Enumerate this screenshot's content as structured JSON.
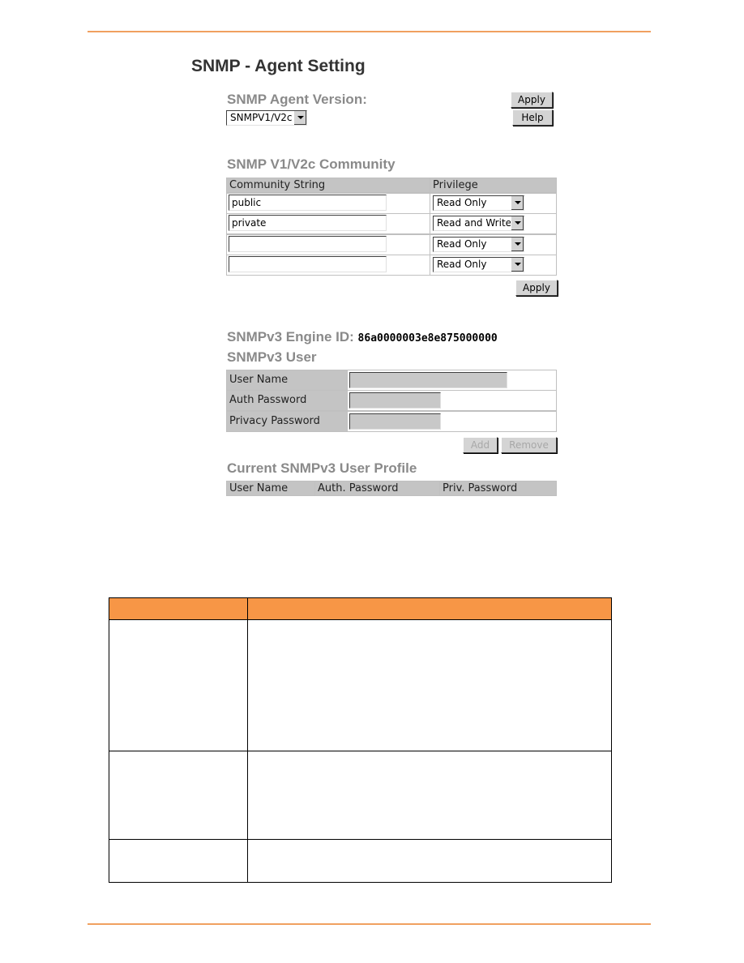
{
  "title": "SNMP - Agent Setting",
  "agent_version": {
    "label": "SNMP Agent Version:",
    "selected": "SNMPV1/V2c",
    "apply": "Apply",
    "help": "Help"
  },
  "community": {
    "heading": "SNMP V1/V2c Community",
    "columns": [
      "Community String",
      "Privilege"
    ],
    "rows": [
      {
        "string": "public",
        "privilege": "Read Only"
      },
      {
        "string": "private",
        "privilege": "Read and Write"
      },
      {
        "string": "",
        "privilege": "Read Only"
      },
      {
        "string": "",
        "privilege": "Read Only"
      }
    ],
    "apply": "Apply"
  },
  "engine": {
    "label": "SNMPv3 Engine ID:",
    "value": "86a0000003e8e875000000"
  },
  "v3user": {
    "heading": "SNMPv3 User",
    "fields": [
      "User Name",
      "Auth Password",
      "Privacy Password"
    ],
    "add": "Add",
    "remove": "Remove"
  },
  "profile": {
    "heading": "Current SNMPv3 User Profile",
    "columns": [
      "User Name",
      "Auth. Password",
      "Priv. Password"
    ]
  },
  "colors": {
    "accent": "#f79646",
    "rule": "#f0a060"
  }
}
